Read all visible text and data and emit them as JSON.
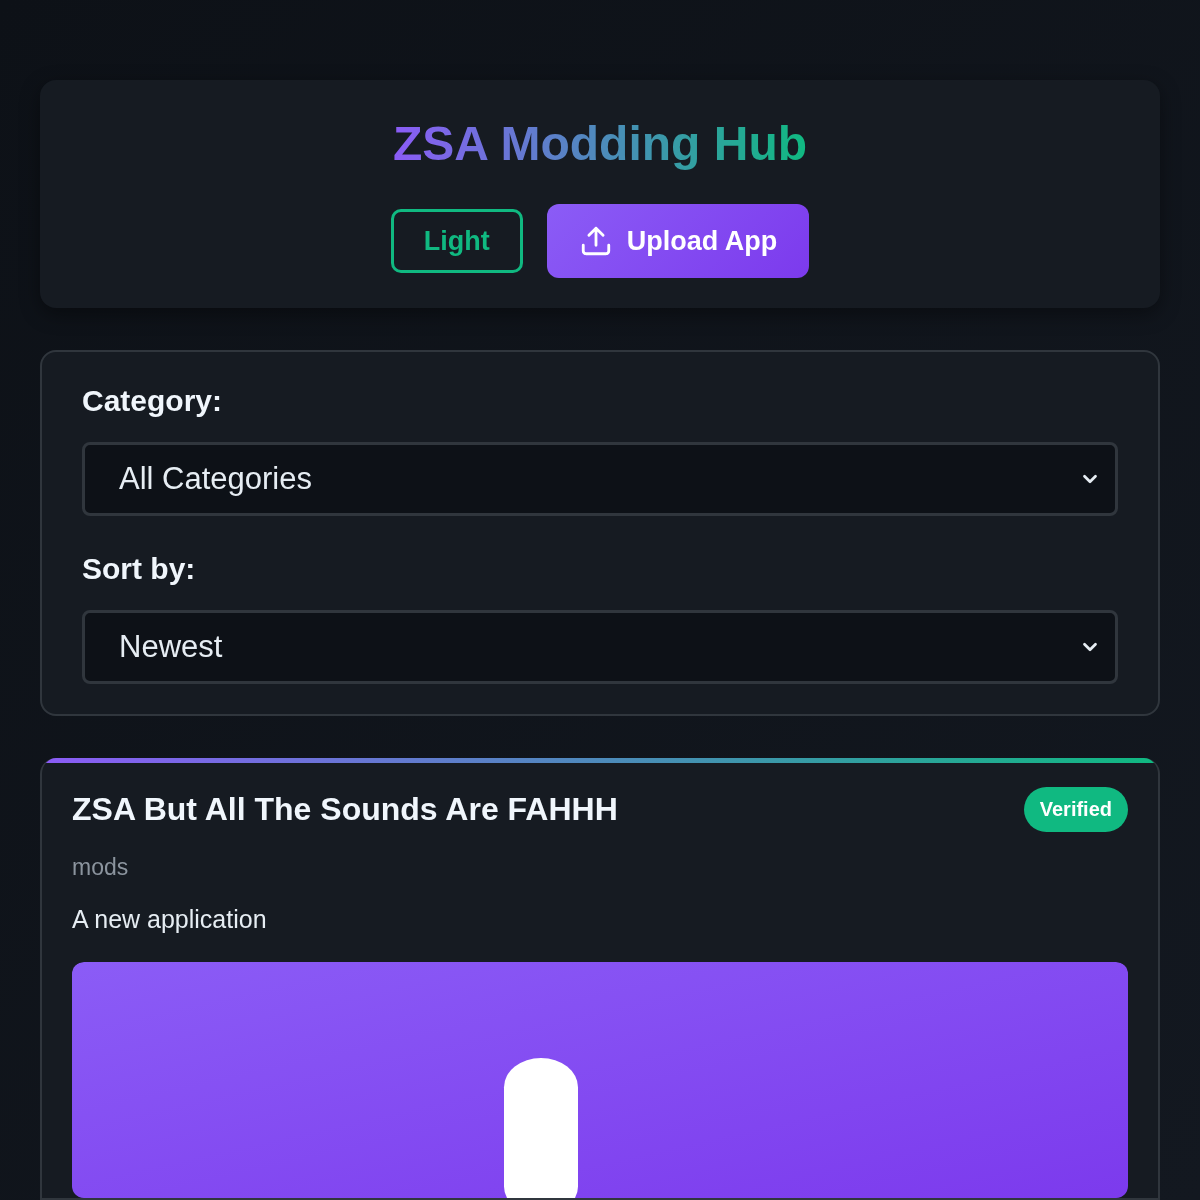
{
  "header": {
    "title": "ZSA Modding Hub",
    "theme_button": "Light",
    "upload_button": "Upload App"
  },
  "filters": [
    {
      "label": "Category:",
      "value": "All Categories"
    },
    {
      "label": "Sort by:",
      "value": "Newest"
    }
  ],
  "apps": [
    {
      "title": "ZSA But All The Sounds Are FAHHH",
      "badge": "Verified",
      "category": "mods",
      "description": "A new application"
    }
  ]
}
